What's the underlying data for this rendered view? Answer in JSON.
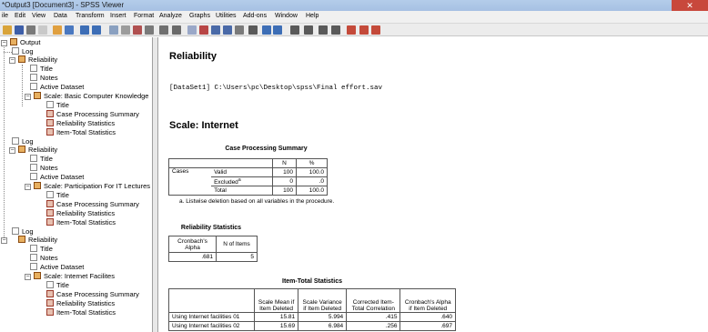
{
  "window": {
    "title": "*Output3 [Document3] - SPSS Viewer",
    "close_glyph": "✕"
  },
  "menu": [
    "ile",
    "Edit",
    "View",
    "Data",
    "Transform",
    "Insert",
    "Format",
    "Analyze",
    "Graphs",
    "Utilities",
    "Add-ons",
    "Window",
    "Help"
  ],
  "outline": {
    "root": "Output",
    "groups": [
      {
        "log": "Log",
        "reliability": "Reliability",
        "title": "Title",
        "notes": "Notes",
        "active_dataset": "Active Dataset",
        "scale": "Scale: Basic Computer Knowledge",
        "scale_title": "Title",
        "case_summary": "Case Processing Summary",
        "rel_stats": "Reliability Statistics",
        "item_total": "Item-Total Statistics"
      },
      {
        "log": "Log",
        "reliability": "Reliability",
        "title": "Title",
        "notes": "Notes",
        "active_dataset": "Active Dataset",
        "scale": "Scale: Participation For IT Lectures",
        "scale_title": "Title",
        "case_summary": "Case Processing Summary",
        "rel_stats": "Reliability Statistics",
        "item_total": "Item-Total Statistics"
      },
      {
        "log": "Log",
        "reliability": "Reliability",
        "title": "Title",
        "notes": "Notes",
        "active_dataset": "Active Dataset",
        "scale": "Scale: Internet Facilites",
        "scale_title": "Title",
        "case_summary": "Case Processing Summary",
        "rel_stats": "Reliability Statistics",
        "item_total": "Item-Total Statistics"
      }
    ]
  },
  "content": {
    "heading": "Reliability",
    "dataset_line": "[DataSet1] C:\\Users\\pc\\Desktop\\spss\\Final effort.sav",
    "scale_heading": "Scale: Internet",
    "case_summary": {
      "title": "Case Processing Summary",
      "col_n": "N",
      "col_pct": "%",
      "group_label": "Cases",
      "rows": [
        {
          "label": "Valid",
          "n": "100",
          "pct": "100.0"
        },
        {
          "label": "Excluded",
          "sup": "a",
          "n": "0",
          "pct": ".0"
        },
        {
          "label": "Total",
          "n": "100",
          "pct": "100.0"
        }
      ],
      "footnote": "a. Listwise deletion based on all variables in the procedure."
    },
    "reliability_stats": {
      "title": "Reliability Statistics",
      "col_alpha": "Cronbach's Alpha",
      "col_items": "N of Items",
      "alpha": ".681",
      "items": "5"
    },
    "item_total": {
      "title": "Item-Total Statistics",
      "cols": [
        "Scale Mean if Item Deleted",
        "Scale Variance if Item Deleted",
        "Corrected Item-Total Correlation",
        "Cronbach's Alpha if Item Deleted"
      ],
      "rows": [
        {
          "label": "Using Internet facilities 01",
          "v": [
            "15.81",
            "5.994",
            ".415",
            ".640"
          ]
        },
        {
          "label": "Using Internet facilities 02",
          "v": [
            "15.69",
            "6.984",
            ".256",
            ".697"
          ]
        }
      ]
    }
  }
}
